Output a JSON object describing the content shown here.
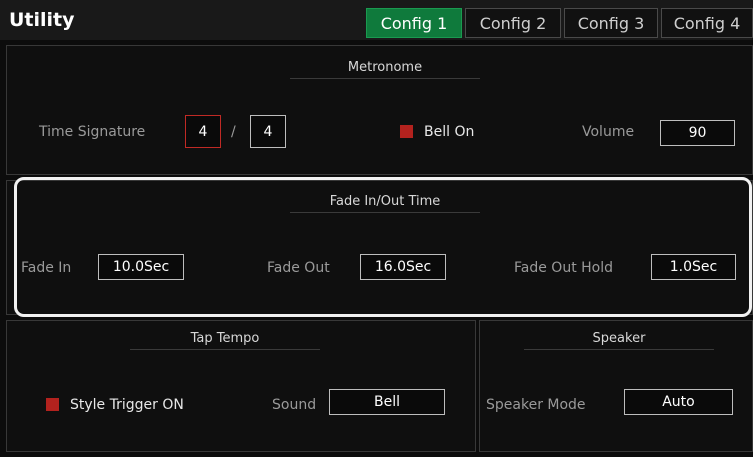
{
  "header": {
    "title": "Utility",
    "tabs": [
      {
        "label": "Config 1",
        "active": true
      },
      {
        "label": "Config 2",
        "active": false
      },
      {
        "label": "Config 3",
        "active": false
      },
      {
        "label": "Config 4",
        "active": false
      }
    ]
  },
  "metronome": {
    "title": "Metronome",
    "time_signature_label": "Time Signature",
    "numerator": "4",
    "separator": "/",
    "denominator": "4",
    "bell_label": "Bell On",
    "volume_label": "Volume",
    "volume": "90"
  },
  "fade": {
    "title": "Fade In/Out Time",
    "fade_in_label": "Fade In",
    "fade_in_value": "10.0Sec",
    "fade_out_label": "Fade Out",
    "fade_out_value": "16.0Sec",
    "fade_out_hold_label": "Fade Out Hold",
    "fade_out_hold_value": "1.0Sec"
  },
  "tap_tempo": {
    "title": "Tap Tempo",
    "style_trigger_label": "Style Trigger ON",
    "sound_label": "Sound",
    "sound_value": "Bell"
  },
  "speaker": {
    "title": "Speaker",
    "mode_label": "Speaker Mode",
    "mode_value": "Auto"
  },
  "colors": {
    "active_tab": "#0f7a3c",
    "checkbox": "#b3221e",
    "highlight": "#f2f2f2"
  }
}
